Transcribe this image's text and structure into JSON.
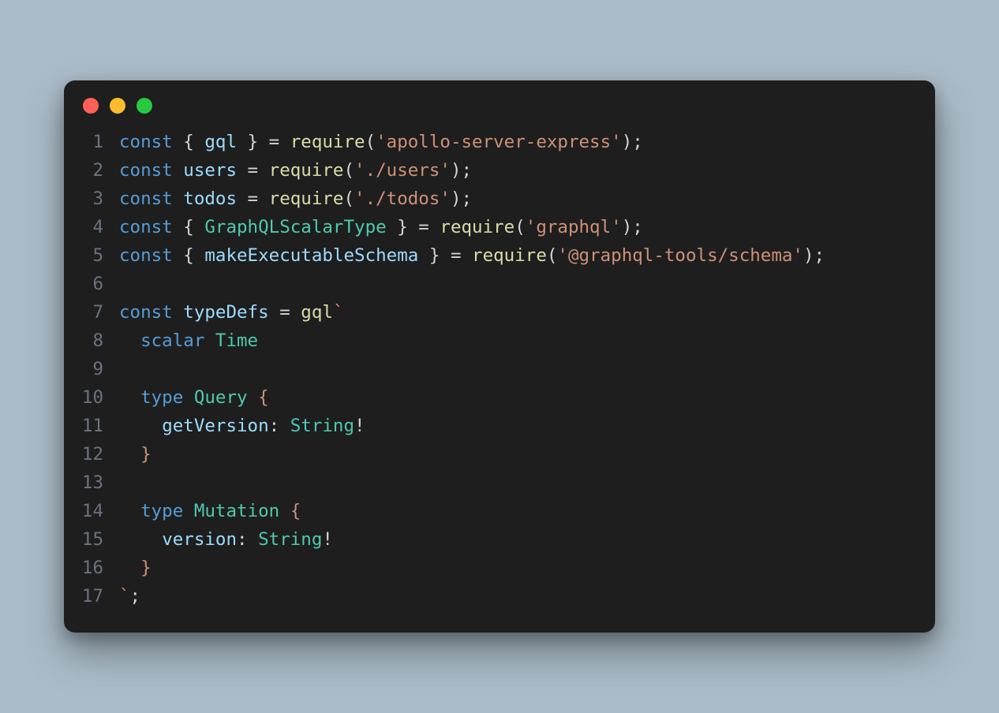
{
  "theme": {
    "page_bg": "#abbcc8",
    "editor_bg": "#1e1e1e",
    "dot_close": "#ff5f56",
    "dot_min": "#ffbd2e",
    "dot_max": "#27c93f",
    "gutter_color": "#6b7280",
    "default_text": "#d4d4d4",
    "kw": "#569cd6",
    "fn": "#dcdcaa",
    "var": "#9cdcfe",
    "cls": "#4ec9b0",
    "str": "#ce9178"
  },
  "lines": [
    {
      "n": "1",
      "tokens": [
        [
          "kw",
          "const"
        ],
        [
          "punct",
          " { "
        ],
        [
          "var",
          "gql"
        ],
        [
          "punct",
          " } = "
        ],
        [
          "fn",
          "require"
        ],
        [
          "punct",
          "("
        ],
        [
          "str",
          "'apollo-server-express'"
        ],
        [
          "punct",
          ");"
        ]
      ]
    },
    {
      "n": "2",
      "tokens": [
        [
          "kw",
          "const"
        ],
        [
          "punct",
          " "
        ],
        [
          "var",
          "users"
        ],
        [
          "punct",
          " = "
        ],
        [
          "fn",
          "require"
        ],
        [
          "punct",
          "("
        ],
        [
          "str",
          "'./users'"
        ],
        [
          "punct",
          ");"
        ]
      ]
    },
    {
      "n": "3",
      "tokens": [
        [
          "kw",
          "const"
        ],
        [
          "punct",
          " "
        ],
        [
          "var",
          "todos"
        ],
        [
          "punct",
          " = "
        ],
        [
          "fn",
          "require"
        ],
        [
          "punct",
          "("
        ],
        [
          "str",
          "'./todos'"
        ],
        [
          "punct",
          ");"
        ]
      ]
    },
    {
      "n": "4",
      "tokens": [
        [
          "kw",
          "const"
        ],
        [
          "punct",
          " { "
        ],
        [
          "cls",
          "GraphQLScalarType"
        ],
        [
          "punct",
          " } = "
        ],
        [
          "fn",
          "require"
        ],
        [
          "punct",
          "("
        ],
        [
          "str",
          "'graphql'"
        ],
        [
          "punct",
          ");"
        ]
      ]
    },
    {
      "n": "5",
      "tokens": [
        [
          "kw",
          "const"
        ],
        [
          "punct",
          " { "
        ],
        [
          "var",
          "makeExecutableSchema"
        ],
        [
          "punct",
          " } = "
        ],
        [
          "fn",
          "require"
        ],
        [
          "punct",
          "("
        ],
        [
          "str",
          "'@graphql-tools/schema'"
        ],
        [
          "punct",
          ");"
        ]
      ]
    },
    {
      "n": "6",
      "tokens": []
    },
    {
      "n": "7",
      "tokens": [
        [
          "kw",
          "const"
        ],
        [
          "punct",
          " "
        ],
        [
          "var",
          "typeDefs"
        ],
        [
          "punct",
          " = "
        ],
        [
          "fn",
          "gql"
        ],
        [
          "str",
          "`"
        ]
      ]
    },
    {
      "n": "8",
      "tokens": [
        [
          "str",
          "  "
        ],
        [
          "kw",
          "scalar"
        ],
        [
          "str",
          " "
        ],
        [
          "cls",
          "Time"
        ]
      ]
    },
    {
      "n": "9",
      "tokens": []
    },
    {
      "n": "10",
      "tokens": [
        [
          "str",
          "  "
        ],
        [
          "kw",
          "type"
        ],
        [
          "str",
          " "
        ],
        [
          "cls",
          "Query"
        ],
        [
          "str",
          " {"
        ]
      ]
    },
    {
      "n": "11",
      "tokens": [
        [
          "str",
          "    "
        ],
        [
          "var",
          "getVersion"
        ],
        [
          "punct",
          ": "
        ],
        [
          "cls",
          "String"
        ],
        [
          "punct",
          "!"
        ]
      ]
    },
    {
      "n": "12",
      "tokens": [
        [
          "str",
          "  }"
        ]
      ]
    },
    {
      "n": "13",
      "tokens": []
    },
    {
      "n": "14",
      "tokens": [
        [
          "str",
          "  "
        ],
        [
          "kw",
          "type"
        ],
        [
          "str",
          " "
        ],
        [
          "cls",
          "Mutation"
        ],
        [
          "str",
          " {"
        ]
      ]
    },
    {
      "n": "15",
      "tokens": [
        [
          "str",
          "    "
        ],
        [
          "var",
          "version"
        ],
        [
          "punct",
          ": "
        ],
        [
          "cls",
          "String"
        ],
        [
          "punct",
          "!"
        ]
      ]
    },
    {
      "n": "16",
      "tokens": [
        [
          "str",
          "  }"
        ]
      ]
    },
    {
      "n": "17",
      "tokens": [
        [
          "str",
          "`"
        ],
        [
          "punct",
          ";"
        ]
      ]
    }
  ]
}
